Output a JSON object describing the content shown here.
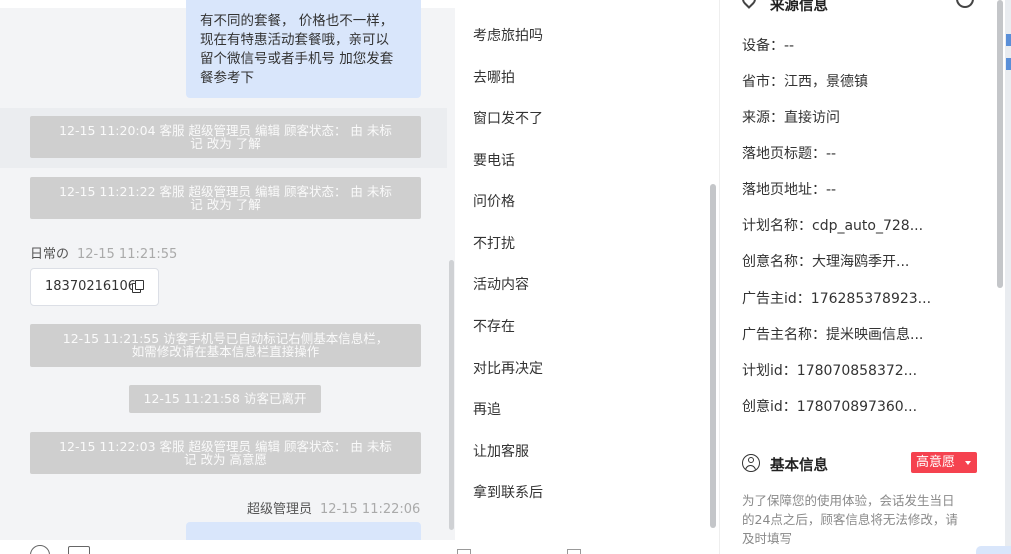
{
  "chat": {
    "agent_message_lines": [
      "有不同的套餐， 价格也不一样，",
      "现在有特惠活动套餐哦，亲可以",
      "留个微信号或者手机号 加您发套",
      "餐参考下"
    ],
    "system_messages": [
      {
        "line1": "12-15 11:20:04 客服 超级管理员 编辑 顾客状态： 由 未标",
        "line2": "记 改为 了解"
      },
      {
        "line1": "12-15 11:21:22 客服 超级管理员 编辑 顾客状态： 由 未标",
        "line2": "记 改为 了解"
      },
      {
        "line1": "12-15 11:21:55 访客手机号已自动标记右侧基本信息栏，",
        "line2": "如需修改请在基本信息栏直接操作"
      },
      {
        "line1": "12-15 11:21:58 访客已离开",
        "line2": ""
      },
      {
        "line1": "12-15 11:22:03 客服 超级管理员 编辑 顾客状态： 由 未标",
        "line2": "记 改为 高意愿"
      }
    ],
    "visitor_label": "日常の",
    "visitor_time": "12-15 11:21:55",
    "phone_number": "18370216106",
    "agent_name": "超级管理员",
    "agent_time": "12-15 11:22:06"
  },
  "quick_replies": [
    "考虑旅拍吗",
    "去哪拍",
    "窗口发不了",
    "要电话",
    "问价格",
    "不打扰",
    "活动内容",
    "不存在",
    "对比再决定",
    "再追",
    "让加客服",
    "拿到联系后"
  ],
  "source_info": {
    "title": "来源信息",
    "rows": [
      {
        "label": "设备：",
        "value": "--"
      },
      {
        "label": "省市：",
        "value": "江西，景德镇"
      },
      {
        "label": "来源：",
        "value": "直接访问"
      },
      {
        "label": "落地页标题：",
        "value": "--"
      },
      {
        "label": "落地页地址：",
        "value": "--"
      },
      {
        "label": "计划名称：",
        "value": "cdp_auto_728..."
      },
      {
        "label": "创意名称：",
        "value": "大理海鸥季开..."
      },
      {
        "label": "广告主id：",
        "value": "176285378923..."
      },
      {
        "label": "广告主名称：",
        "value": "提米映画信息..."
      },
      {
        "label": "计划id：",
        "value": "178070858372..."
      },
      {
        "label": "创意id：",
        "value": "178070897360..."
      }
    ]
  },
  "basic_info": {
    "title": "基本信息",
    "intent_badge": "高意愿",
    "note_lines": [
      "为了保障您的使用体验，会话发生当日",
      "的24点之后，顾客信息将无法修改，请",
      "及时填写"
    ]
  },
  "colors": {
    "agent_bubble": "#d9e6fb",
    "system_bubble": "#cfcfcf",
    "badge": "#f5424f",
    "chat_background": "#f3f4f6"
  }
}
